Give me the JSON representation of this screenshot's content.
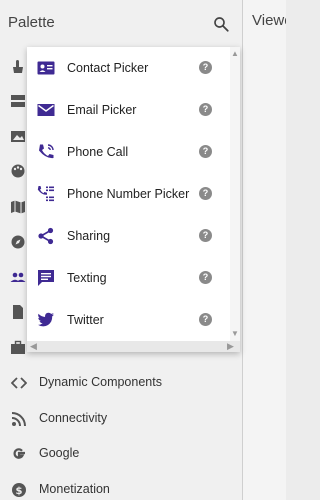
{
  "palette": {
    "title": "Palette",
    "search_icon": "search-icon"
  },
  "viewer": {
    "title": "Viewer"
  },
  "colors": {
    "accent": "#3f2a93",
    "icon_gray": "#555555",
    "help_badge": "#8a8a8a"
  },
  "category_icons": [
    "user-interface-icon",
    "layout-icon",
    "media-icon",
    "drawing-animation-icon",
    "maps-icon",
    "sensors-icon",
    "social-icon",
    "storage-icon",
    "connectivity-briefcase-icon"
  ],
  "social_components": [
    {
      "label": "Contact Picker",
      "icon": "contact-card-icon",
      "help": "?"
    },
    {
      "label": "Email Picker",
      "icon": "email-icon",
      "help": "?"
    },
    {
      "label": "Phone Call",
      "icon": "phone-call-icon",
      "help": "?"
    },
    {
      "label": "Phone Number Picker",
      "icon": "phone-number-list-icon",
      "help": "?"
    },
    {
      "label": "Sharing",
      "icon": "share-icon",
      "help": "?"
    },
    {
      "label": "Texting",
      "icon": "texting-icon",
      "help": "?"
    },
    {
      "label": "Twitter",
      "icon": "twitter-icon",
      "help": "?"
    }
  ],
  "categories": [
    {
      "label": "Dynamic Components",
      "icon": "code-brackets-icon"
    },
    {
      "label": "Connectivity",
      "icon": "rss-icon"
    },
    {
      "label": "Google",
      "icon": "google-icon"
    },
    {
      "label": "Monetization",
      "icon": "money-icon"
    }
  ]
}
